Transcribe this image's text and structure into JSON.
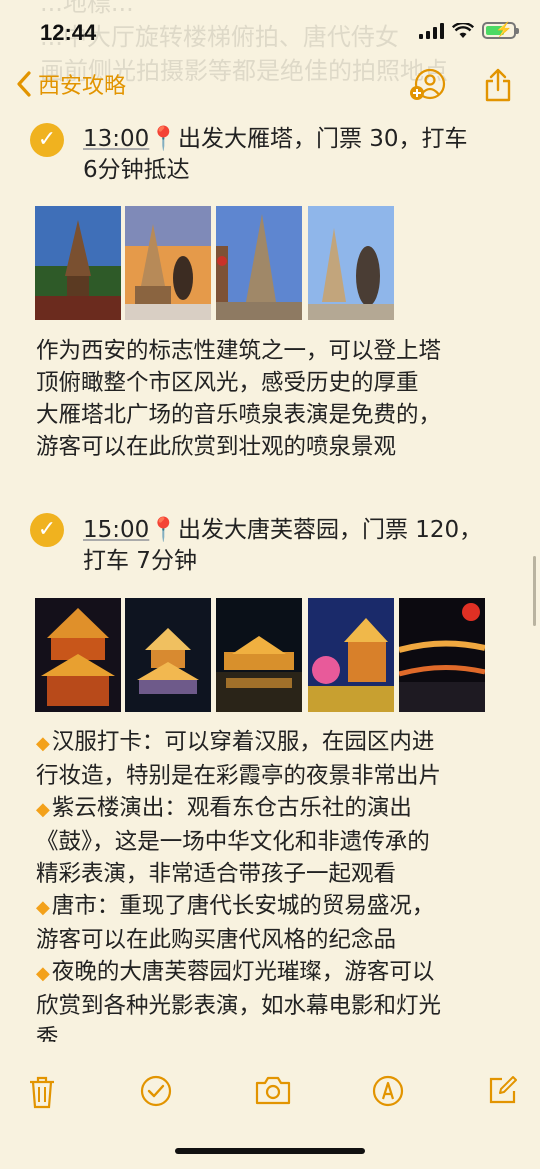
{
  "status_bar": {
    "time": "12:44"
  },
  "ghost_text": [
    "...地標...",
    "...中大厅旋转楼梯俯拍、唐代侍女",
    "画前侧光拍摄影等都是绝佳的拍照地点"
  ],
  "navbar": {
    "back_label": "西安攻略"
  },
  "entries": [
    {
      "time": "13:00",
      "pin": "📍",
      "title_rest": "出发大雁塔，门票 30，打车",
      "title_line2": "6分钟抵达",
      "paragraph": [
        "作为西安的标志性建筑之一，可以登上塔",
        "顶俯瞰整个市区风光，感受历史的厚重",
        "大雁塔北广场的音乐喷泉表演是免费的，",
        "游客可以在此欣赏到壮观的喷泉景观"
      ]
    },
    {
      "time": "15:00",
      "pin": "📍",
      "title_rest": "出发大唐芙蓉园，门票 120，",
      "title_line2": "打车 7分钟",
      "bullets_lines": [
        {
          "bullet": true,
          "text": "汉服打卡：可以穿着汉服，在园区内进"
        },
        {
          "bullet": false,
          "text": "行妆造，特别是在彩霞亭的夜景非常出片"
        },
        {
          "bullet": true,
          "text": "紫云楼演出：观看东仓古乐社的演出"
        },
        {
          "bullet": false,
          "text": "《鼓》，这是一场中华文化和非遗传承的"
        },
        {
          "bullet": false,
          "text": "精彩表演，非常适合带孩子一起观看"
        },
        {
          "bullet": true,
          "text": "唐市：重现了唐代长安城的贸易盛况，"
        },
        {
          "bullet": false,
          "text": "游客可以在此购买唐代风格的纪念品"
        },
        {
          "bullet": true,
          "text": "夜晚的大唐芙蓉园灯光璀璨，游客可以"
        },
        {
          "bullet": false,
          "text": "欣赏到各种光影表演，如水幕电影和灯光"
        },
        {
          "bullet": false,
          "text": "秀"
        }
      ]
    }
  ],
  "colors": {
    "accent": "#e29400",
    "check": "#f0b21f",
    "background": "#f8f2df"
  },
  "icons": [
    "chevron-left-icon",
    "add-person-icon",
    "share-icon",
    "trash-icon",
    "checklist-icon",
    "camera-icon",
    "markup-icon",
    "compose-icon"
  ]
}
